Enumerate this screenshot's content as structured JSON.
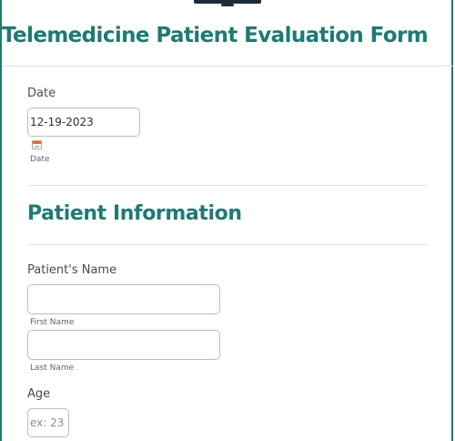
{
  "header": {
    "logo_icon": "computer-monitor-icon",
    "title": "Telemedicine Patient Evaluation Form"
  },
  "date_field": {
    "label": "Date",
    "value": "12-19-2023",
    "sublabel": "Date",
    "icon": "calendar-icon"
  },
  "patient_information": {
    "heading": "Patient Information",
    "name": {
      "label": "Patient's Name",
      "first_value": "",
      "first_sublabel": "First Name",
      "last_value": "",
      "last_sublabel": "Last Name"
    },
    "age": {
      "label": "Age",
      "placeholder": "ex: 23"
    }
  },
  "colors": {
    "accent": "#1f7a72",
    "label_text": "#4a4a55",
    "input_border": "#b9bec9"
  }
}
